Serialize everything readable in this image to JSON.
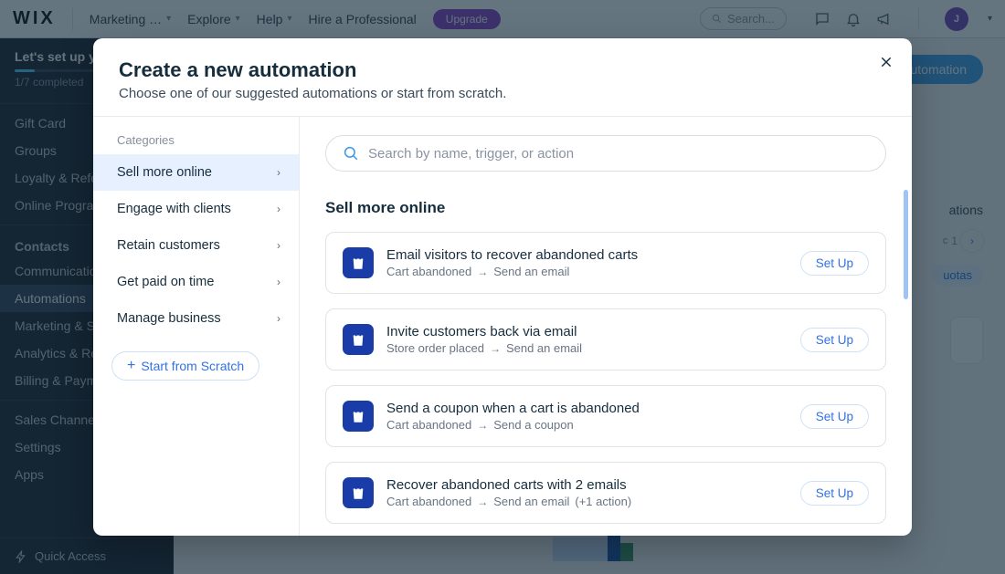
{
  "topbar": {
    "logo": "WIX",
    "nav_marketing": "Marketing …",
    "nav_explore": "Explore",
    "nav_help": "Help",
    "nav_hire": "Hire a Professional",
    "upgrade": "Upgrade",
    "search_placeholder": "Search...",
    "avatar_initial": "J"
  },
  "sidebar": {
    "setup_title": "Let's set up you",
    "progress_text": "1/7 completed",
    "items_a": [
      "Gift Card",
      "Groups",
      "Loyalty & Refer",
      "Online Program"
    ],
    "heading_contacts": "Contacts",
    "items_b": [
      "Communication",
      "Automations",
      "Marketing & SE",
      "Analytics & Rep",
      "Billing & Payme"
    ],
    "items_c": [
      "Sales Channels",
      "Settings",
      "Apps"
    ],
    "quick_access": "Quick Access"
  },
  "main": {
    "new_automation": "+ New Automation",
    "right1": "ations",
    "right2": "1",
    "quotas": "uotas"
  },
  "modal": {
    "title": "Create a new automation",
    "subtitle": "Choose one of our suggested automations or start from scratch.",
    "categories_heading": "Categories",
    "categories": [
      {
        "label": "Sell more online",
        "active": true
      },
      {
        "label": "Engage with clients"
      },
      {
        "label": "Retain customers"
      },
      {
        "label": "Get paid on time"
      },
      {
        "label": "Manage business"
      }
    ],
    "start_from_scratch": "Start from Scratch",
    "search_placeholder": "Search by name, trigger, or action",
    "section_title": "Sell more online",
    "setup_label": "Set Up",
    "automations": [
      {
        "title": "Email visitors to recover abandoned carts",
        "trigger": "Cart abandoned",
        "action": "Send an email",
        "extra": ""
      },
      {
        "title": "Invite customers back via email",
        "trigger": "Store order placed",
        "action": "Send an email",
        "extra": ""
      },
      {
        "title": "Send a coupon when a cart is abandoned",
        "trigger": "Cart abandoned",
        "action": "Send a coupon",
        "extra": ""
      },
      {
        "title": "Recover abandoned carts with 2 emails",
        "trigger": "Cart abandoned",
        "action": "Send an email",
        "extra": "(+1 action)"
      }
    ]
  }
}
